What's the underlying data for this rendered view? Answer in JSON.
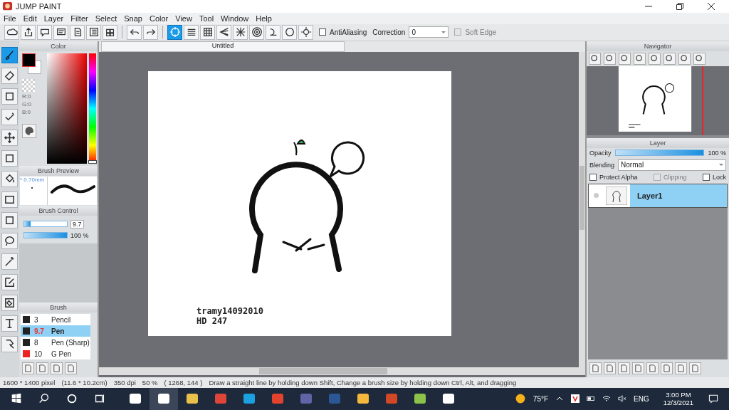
{
  "window": {
    "title": "JUMP PAINT"
  },
  "menu": [
    "File",
    "Edit",
    "Layer",
    "Filter",
    "Select",
    "Snap",
    "Color",
    "View",
    "Tool",
    "Window",
    "Help"
  ],
  "toolbar": {
    "buttons": [
      {
        "selected": false
      },
      {
        "selected": false
      },
      {
        "selected": false
      },
      {
        "selected": false
      },
      {
        "selected": false
      },
      {
        "selected": false
      },
      {
        "selected": false
      },
      {
        "selected": false
      },
      {
        "selected": false
      },
      {
        "selected": true
      },
      {
        "selected": false
      },
      {
        "selected": false
      },
      {
        "selected": false
      },
      {
        "selected": false
      },
      {
        "selected": false
      },
      {
        "selected": false
      },
      {
        "selected": false
      },
      {
        "selected": false
      }
    ],
    "antialiasing": {
      "label": "AntiAliasing",
      "checked": false
    },
    "correction": {
      "label": "Correction",
      "value": "0"
    },
    "soft_edge": {
      "label": "Soft Edge",
      "checked": false,
      "disabled": true
    }
  },
  "tools": [
    {
      "selected": true
    },
    {
      "selected": false
    },
    {
      "selected": false
    },
    {
      "selected": false
    },
    {
      "selected": false
    },
    {
      "selected": false
    },
    {
      "selected": false
    },
    {
      "selected": false
    },
    {
      "selected": false
    },
    {
      "selected": false
    },
    {
      "selected": false
    },
    {
      "selected": false
    },
    {
      "selected": false
    },
    {
      "selected": false
    },
    {
      "selected": false
    }
  ],
  "color_panel": {
    "title": "Color",
    "rgb": [
      "R:0",
      "G:0",
      "B:0"
    ],
    "hue": {
      "level": 0
    }
  },
  "brush_preview": {
    "title": "Brush Preview",
    "size": "* 0.70mm"
  },
  "brush_control": {
    "title": "Brush Control",
    "size": {
      "level": 0.15,
      "value": "9.7"
    },
    "opacity": {
      "level": 1,
      "value": "100 %"
    }
  },
  "brush_panel": {
    "title": "Brush",
    "items": [
      {
        "size": "3",
        "name": "Pencil",
        "color": "#222222",
        "selected": false
      },
      {
        "size": "9.7",
        "name": "Pen",
        "color": "#222222",
        "selected": true
      },
      {
        "size": "8",
        "name": "Pen (Sharp)",
        "color": "#222222",
        "selected": false
      },
      {
        "size": "10",
        "name": "G Pen",
        "color": "#ee2222",
        "selected": false
      }
    ]
  },
  "document": {
    "title": "Untitled",
    "canvas_text": [
      "tramy14092010",
      "HD 247"
    ]
  },
  "navigator": {
    "title": "Navigator"
  },
  "layer_panel": {
    "title": "Layer",
    "opacity": {
      "label": "Opacity",
      "level": 1,
      "value": "100 %"
    },
    "blending": {
      "label": "Blending",
      "value": "Normal"
    },
    "options": [
      {
        "label": "Protect Alpha",
        "checked": false,
        "disabled": false
      },
      {
        "label": "Clipping",
        "checked": false,
        "disabled": true
      },
      {
        "label": "Lock",
        "checked": false,
        "disabled": false
      }
    ],
    "layers": [
      {
        "name": "Layer1",
        "selected": true
      }
    ]
  },
  "status_bar": [
    "1600 * 1400 pixel",
    "(11.6 * 10.2cm)",
    "350 dpi",
    "50 %",
    "( 1268, 144 )",
    "Draw a straight line by holding down Shift, Change a brush size by holding down Ctrl, Alt, and dragging"
  ],
  "taskbar": {
    "apps": [
      {
        "selected": false
      },
      {
        "selected": true
      },
      {
        "selected": false
      },
      {
        "selected": false
      },
      {
        "selected": false
      },
      {
        "selected": false
      },
      {
        "selected": false
      },
      {
        "selected": false
      },
      {
        "selected": false
      },
      {
        "selected": false
      },
      {
        "selected": false
      },
      {
        "selected": false
      }
    ],
    "temperature": "75°F",
    "language": "ENG",
    "time": "3:00 PM",
    "date": "12/3/2021"
  }
}
